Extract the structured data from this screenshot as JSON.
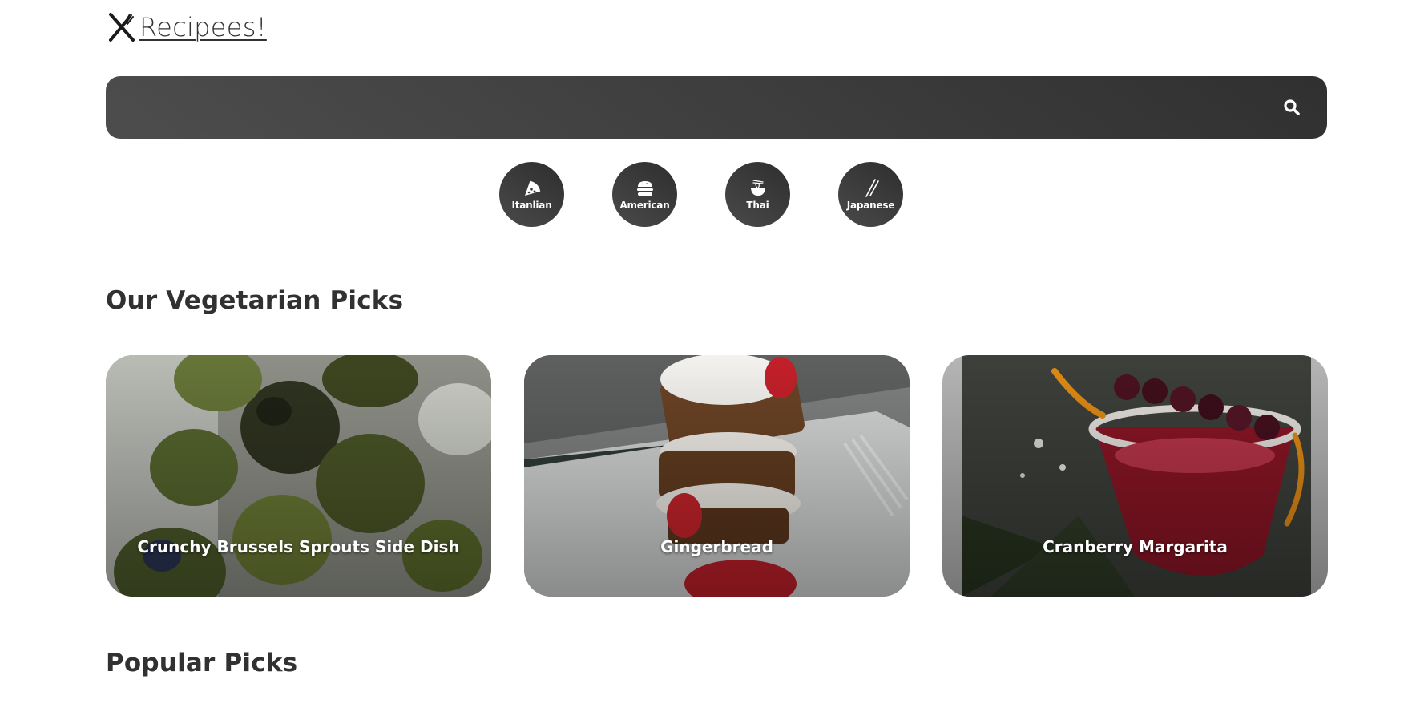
{
  "logo": {
    "text": "Recipees!",
    "icon": "fork-knife-icon"
  },
  "search": {
    "value": "",
    "placeholder": "",
    "icon": "search-icon"
  },
  "cuisines": [
    {
      "label": "Itanlian",
      "icon": "pizza-icon"
    },
    {
      "label": "American",
      "icon": "burger-icon"
    },
    {
      "label": "Thai",
      "icon": "noodle-bowl-icon"
    },
    {
      "label": "Japanese",
      "icon": "chopsticks-icon"
    }
  ],
  "sections": {
    "vegetarian": {
      "title": "Our Vegetarian Picks",
      "cards": [
        {
          "title": "Crunchy Brussels Sprouts Side Dish"
        },
        {
          "title": "Gingerbread"
        },
        {
          "title": "Cranberry Margarita"
        }
      ]
    },
    "popular": {
      "title": "Popular Picks"
    }
  },
  "colors": {
    "text": "#313131",
    "accent_dark": "#3a3a3a",
    "background": "#ffffff"
  }
}
